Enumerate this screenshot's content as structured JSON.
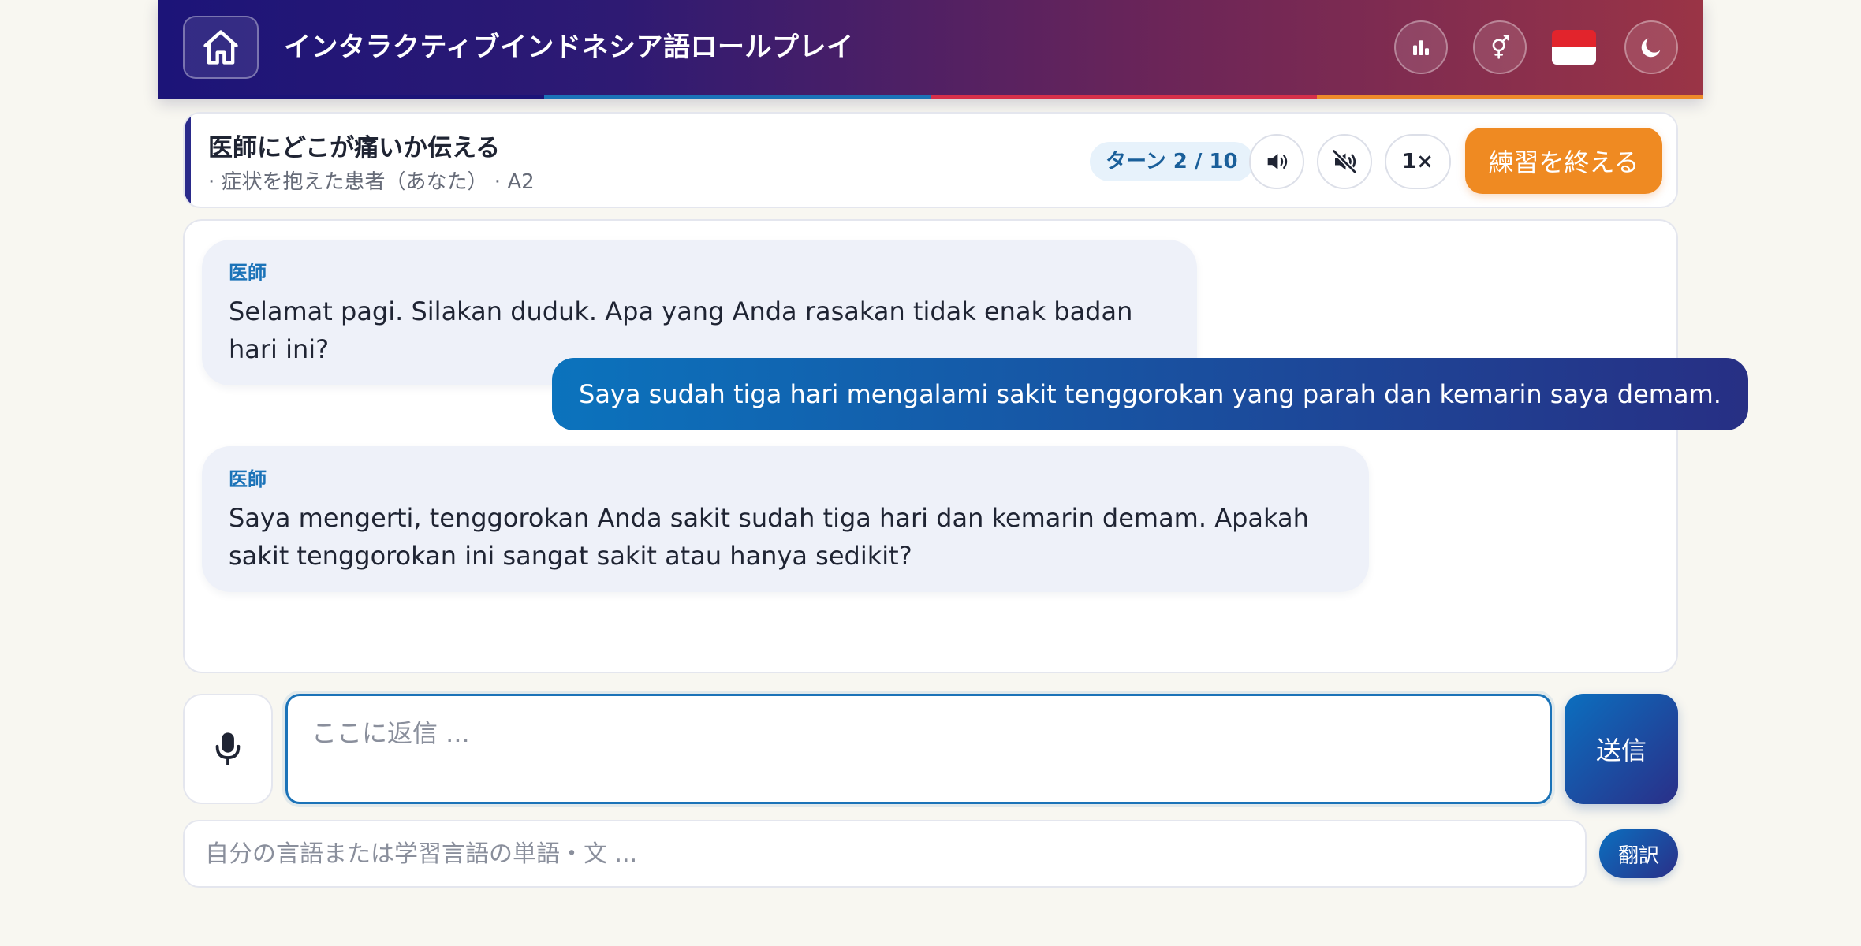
{
  "header": {
    "title": "インタラクティブインドネシア語ロールプレイ",
    "stripe_colors": [
      "#1c1478",
      "#1b73b8",
      "#d6304a",
      "#ee8a2a"
    ],
    "gradient_start": "#1c1478",
    "gradient_end": "#9a3446",
    "icons": {
      "home": "home-icon",
      "stats": "bar-chart-icon",
      "gender": "gender-icon",
      "language_flag": "indonesia-flag",
      "theme": "moon-icon"
    },
    "flag_colors": {
      "top": "#e2242c",
      "bottom": "#ffffff"
    }
  },
  "scenario": {
    "title": "医師にどこが痛いか伝える",
    "subtitle": "· 症状を抱えた患者（あなた） · A2",
    "turn_label": "ターン 2 / 10",
    "speed_label": "1×",
    "end_label": "練習を終える",
    "accent_color": "#2a2a8a",
    "end_button_color": "#ef8a22",
    "icons": {
      "speaker": "speaker-icon",
      "mute": "speaker-muted-icon"
    }
  },
  "chat": {
    "messages": [
      {
        "role": "bot",
        "speaker": "医師",
        "text": "Selamat pagi. Silakan duduk. Apa yang Anda rasakan tidak enak badan hari ini?"
      },
      {
        "role": "user",
        "text": "Saya sudah tiga hari mengalami sakit tenggorokan yang parah dan kemarin saya demam."
      },
      {
        "role": "bot",
        "speaker": "医師",
        "text": "Saya mengerti, tenggorokan Anda sakit sudah tiga hari dan kemarin demam. Apakah sakit tenggorokan ini sangat sakit atau hanya sedikit?"
      }
    ],
    "user_bubble_gradient": [
      "#0b73bd",
      "#272f84"
    ]
  },
  "composer": {
    "reply_placeholder": "ここに返信 ...",
    "send_label": "送信",
    "translate_placeholder": "自分の言語または学習言語の単語・文 ...",
    "translate_label": "翻訳",
    "button_gradient": [
      "#0b6fbf",
      "#2a2f88"
    ],
    "icons": {
      "mic": "microphone-icon"
    }
  }
}
